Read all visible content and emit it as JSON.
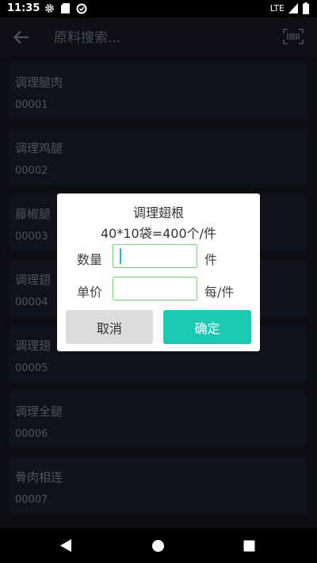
{
  "status_bar": {
    "time": "11:35",
    "network": "LTE"
  },
  "header": {
    "search_placeholder": "原料搜索..."
  },
  "items": [
    {
      "name": "调理腿肉",
      "code": "00001"
    },
    {
      "name": "调理鸡腿",
      "code": "00002"
    },
    {
      "name": "藤椒腿",
      "code": "00003"
    },
    {
      "name": "调理翅",
      "code": "00004"
    },
    {
      "name": "调理翅",
      "code": "00005"
    },
    {
      "name": "调理全腿",
      "code": "00006"
    },
    {
      "name": "骨肉相连",
      "code": "00007"
    }
  ],
  "dialog": {
    "title": "调理翅根",
    "spec": "40*10袋=400个/件",
    "quantity_label": "数量",
    "quantity_value": "",
    "quantity_unit": "件",
    "price_label": "单价",
    "price_value": "",
    "price_unit": "每/件",
    "cancel_label": "取消",
    "confirm_label": "确定"
  },
  "colors": {
    "accent": "#1ec9b2",
    "input_border": "#7fcf7f",
    "background": "#0d0e12"
  }
}
